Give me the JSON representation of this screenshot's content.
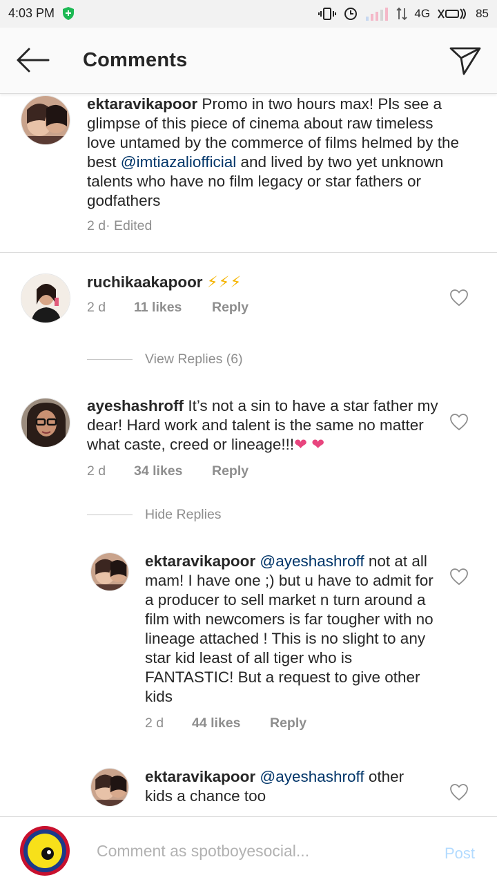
{
  "status_bar": {
    "time": "4:03 PM",
    "network": "4G",
    "battery": "85"
  },
  "header": {
    "title": "Comments",
    "back_icon": "arrow-left-icon",
    "action_icon": "paper-plane-icon"
  },
  "comments": [
    {
      "username": "ektaravikapoor",
      "text_before_mention": " Promo in two hours max! Pls see a glimpse of this piece of cinema about raw timeless love untamed by the commerce of films helmed by the best ",
      "mention": "@imtiazaliofficial",
      "text_after_mention": " and lived by two yet unknown talents who have no film legacy or star fathers or godfathers",
      "time": "2 d",
      "edited": " · Edited"
    },
    {
      "username": "ruchikaakapoor",
      "text": "⚡⚡⚡",
      "time": "2 d",
      "likes": "11 likes",
      "reply": "Reply",
      "replies_toggle": "View Replies (6)"
    },
    {
      "username": "ayeshashroff",
      "text": " It’s not a sin to have a star father my dear! Hard work and talent is the same no matter what caste, creed or lineage!!!",
      "emoji": "❤ ❤",
      "time": "2 d",
      "likes": "34 likes",
      "reply": "Reply",
      "replies_toggle": "Hide Replies"
    }
  ],
  "replies": [
    {
      "username": "ektaravikapoor",
      "mention": "@ayeshashroff",
      "text": " not at all mam! I have one ;) but u have to admit for a producer to sell market n turn around a film with newcomers is far tougher with no lineage attached ! This is no slight to any star kid least of all tiger who is FANTASTIC! But a request to give other kids",
      "time": "2 d",
      "likes": "44 likes",
      "reply": "Reply"
    },
    {
      "username": "ektaravikapoor",
      "mention": "@ayeshashroff",
      "text": " other kids a chance too"
    }
  ],
  "composer": {
    "placeholder": "Comment as spotboyesocial...",
    "post_label": "Post"
  },
  "colors": {
    "mention": "#003569",
    "secondary_text": "#8e8e8e",
    "post_disabled": "#b3dbff",
    "heart": "#e8457e"
  }
}
